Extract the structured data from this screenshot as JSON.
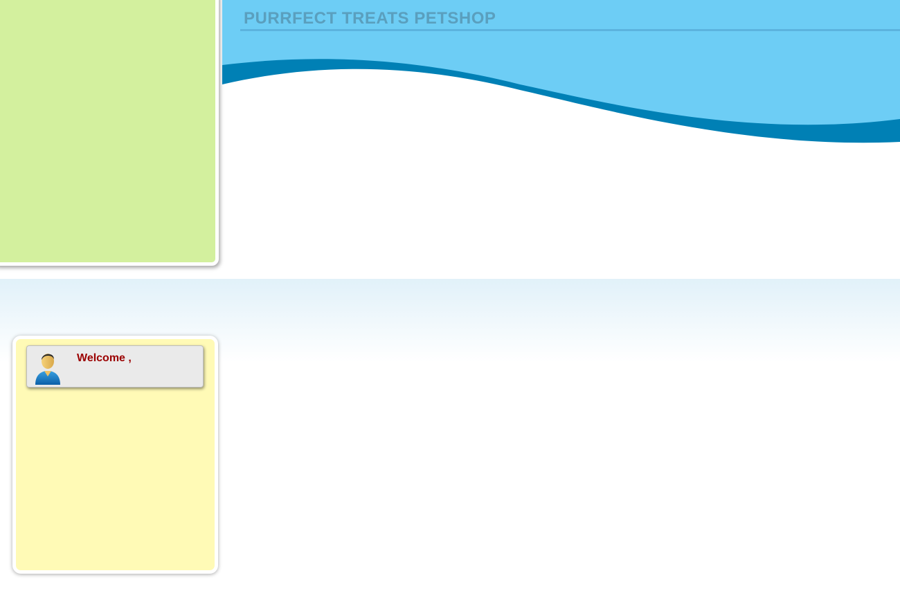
{
  "header": {
    "title": "PURRFECT TREATS PETSHOP"
  },
  "sidebar": {
    "welcome_label": "Welcome ,",
    "user_icon": "user-avatar-icon"
  },
  "colors": {
    "title_text": "#5a9fbe",
    "header_light_blue": "#6dcdf5",
    "header_dark_blue": "#0080b5",
    "green_panel": "#d3f09e",
    "yellow_panel": "#fffab6",
    "welcome_text": "#9b0000"
  }
}
